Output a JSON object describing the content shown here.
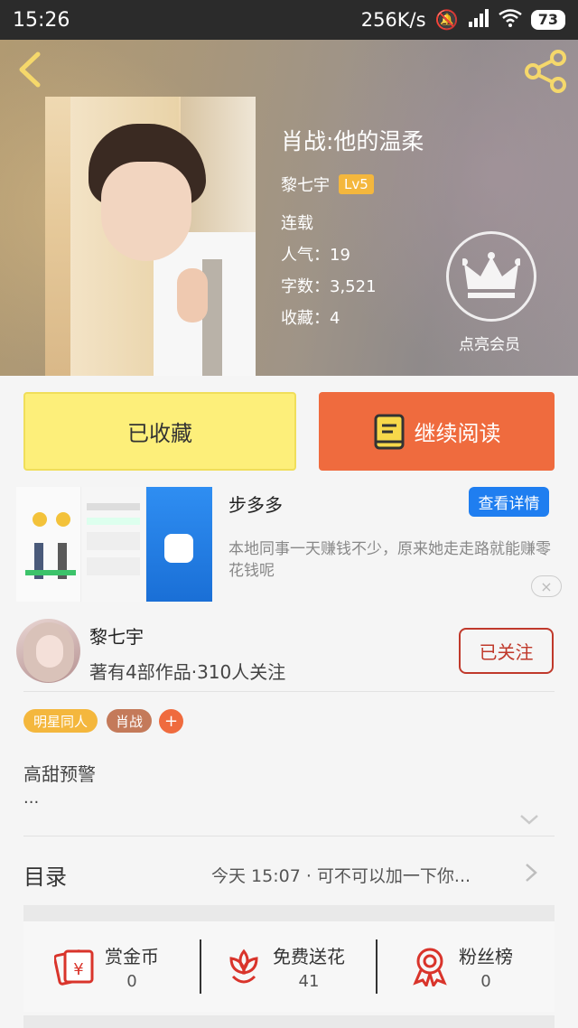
{
  "status_bar": {
    "time": "15:26",
    "net_speed": "256K/s",
    "battery": "73"
  },
  "book": {
    "title": "肖战:他的温柔",
    "author": "黎七宇",
    "level": "Lv5",
    "status": "连载",
    "popularity": "人气：19",
    "words": "字数：3,521",
    "favorites": "收藏：4",
    "vip_label": "点亮会员"
  },
  "actions": {
    "favorited_label": "已收藏",
    "continue_label": "继续阅读"
  },
  "ad": {
    "title": "步多多",
    "detail_button": "查看详情",
    "description": "本地同事一天赚钱不少，原来她走走路就能赚零花钱呢",
    "close_icon": "×"
  },
  "author_card": {
    "name": "黎七宇",
    "summary": "著有4部作品·310人关注",
    "follow_label": "已关注"
  },
  "tags": [
    {
      "label": "明星同人",
      "color": "#f4b73d"
    },
    {
      "label": "肖战",
      "color": "#c47a5a"
    }
  ],
  "tag_add": "+",
  "intro": {
    "text": "高甜预警",
    "more": "..."
  },
  "toc": {
    "label": "目录",
    "latest": "今天 15:07 · 可不可以加一下你..."
  },
  "stats": [
    {
      "label": "赏金币",
      "value": "0",
      "icon": "red-envelope-icon"
    },
    {
      "label": "免费送花",
      "value": "41",
      "icon": "flower-icon"
    },
    {
      "label": "粉丝榜",
      "value": "0",
      "icon": "medal-icon"
    }
  ],
  "colors": {
    "accent_orange": "#ef6b3e",
    "favorite_yellow": "#fdef7a",
    "ad_blue": "#1f7ef0",
    "follow_red": "#c0392b",
    "level_badge": "#f4b73d"
  }
}
